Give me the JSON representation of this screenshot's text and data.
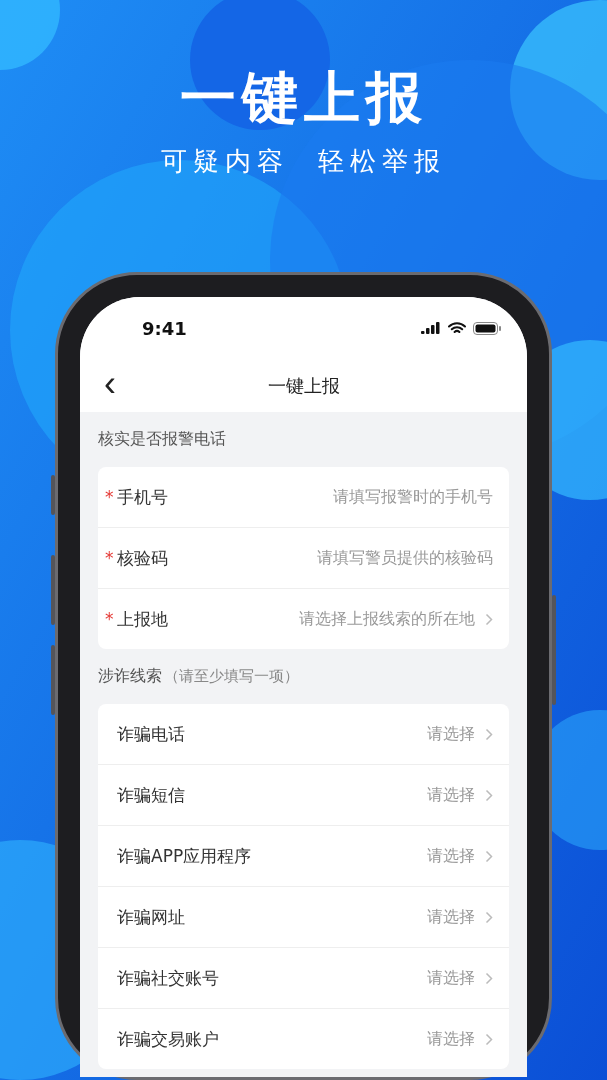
{
  "hero": {
    "title": "一键上报",
    "subtitle": "可疑内容  轻松举报"
  },
  "status_bar": {
    "time": "9:41"
  },
  "nav": {
    "back": "‹",
    "title": "一键上报"
  },
  "sections": [
    {
      "title": "核实是否报警电话",
      "rows": [
        {
          "kind": "input",
          "required_mark": "*",
          "label": "手机号",
          "placeholder": "请填写报警时的手机号"
        },
        {
          "kind": "input",
          "required_mark": "*",
          "label": "核验码",
          "placeholder": "请填写警员提供的核验码"
        },
        {
          "kind": "select",
          "required_mark": "*",
          "label": "上报地",
          "placeholder": "请选择上报线索的所在地"
        }
      ]
    },
    {
      "title": "涉诈线索",
      "note": "（请至少填写一项）",
      "rows": [
        {
          "kind": "select",
          "label": "诈骗电话",
          "placeholder": "请选择"
        },
        {
          "kind": "select",
          "label": "诈骗短信",
          "placeholder": "请选择"
        },
        {
          "kind": "select",
          "label": "诈骗APP应用程序",
          "placeholder": "请选择"
        },
        {
          "kind": "select",
          "label": "诈骗网址",
          "placeholder": "请选择"
        },
        {
          "kind": "select",
          "label": "诈骗社交账号",
          "placeholder": "请选择"
        },
        {
          "kind": "select",
          "label": "诈骗交易账户",
          "placeholder": "请选择"
        }
      ]
    }
  ]
}
